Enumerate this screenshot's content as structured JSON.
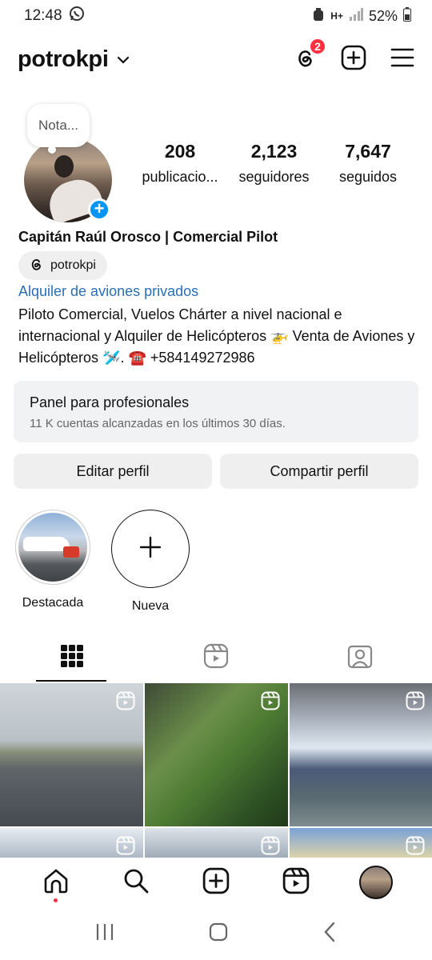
{
  "status_bar": {
    "time": "12:48",
    "network": "H+",
    "battery": "52%"
  },
  "header": {
    "username": "potrokpi",
    "threads_badge": "2"
  },
  "profile": {
    "note_placeholder": "Nota...",
    "stats": [
      {
        "value": "208",
        "label": "publicacio..."
      },
      {
        "value": "2,123",
        "label": "seguidores"
      },
      {
        "value": "7,647",
        "label": "seguidos"
      }
    ],
    "full_name": "Capitán Raúl Orosco | Comercial Pilot",
    "threads_handle": "potrokpi",
    "category": "Alquiler de aviones privados",
    "bio": "Piloto Comercial, Vuelos Chárter a nivel nacional e internacional y Alquiler de Helicópteros 🚁 Venta de Aviones y Helicópteros 🛩️. ☎️ +584149272986"
  },
  "pro_panel": {
    "title": "Panel para profesionales",
    "subtitle": "11 K cuentas alcanzadas en los últimos 30 días."
  },
  "actions": {
    "edit_label": "Editar perfil",
    "share_label": "Compartir perfil"
  },
  "highlights": [
    {
      "label": "Destacada"
    },
    {
      "label": "Nueva"
    }
  ],
  "colors": {
    "accent_blue": "#0095f6",
    "badge_red": "#ff3040",
    "link_blue": "#2a6fb5"
  }
}
